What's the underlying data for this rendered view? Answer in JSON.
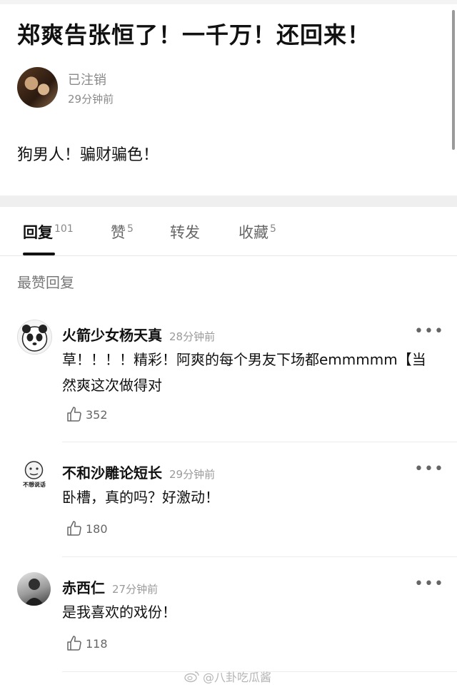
{
  "post": {
    "title": "郑爽告张恒了！一千万！还回来！",
    "author": "已注销",
    "time": "29分钟前",
    "body": "狗男人！骗财骗色！"
  },
  "tabs": [
    {
      "label": "回复",
      "count": "101"
    },
    {
      "label": "赞",
      "count": "5"
    },
    {
      "label": "转发",
      "count": ""
    },
    {
      "label": "收藏",
      "count": "5"
    }
  ],
  "section_label": "最赞回复",
  "comments": [
    {
      "name": "火箭少女杨天真",
      "time": "28分钟前",
      "text": "草！！！！精彩！阿爽的每个男友下场都emmmmm【当然爽这次做得对",
      "likes": "352",
      "avatar_text": ""
    },
    {
      "name": "不和沙雕论短长",
      "time": "29分钟前",
      "text": "卧槽，真的吗？好激动！",
      "likes": "180",
      "avatar_text": "不想说话"
    },
    {
      "name": "赤西仁",
      "time": "27分钟前",
      "text": "是我喜欢的戏份！",
      "likes": "118",
      "avatar_text": ""
    }
  ],
  "more_label": "•••",
  "watermark": "@八卦吃瓜酱",
  "icons": {
    "like": "thumbs-up-icon",
    "more": "more-dots-icon",
    "weibo": "weibo-logo-icon"
  }
}
